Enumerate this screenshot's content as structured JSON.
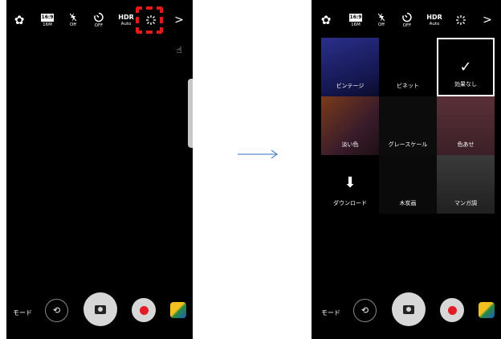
{
  "topbar": {
    "settings_icon": "gear-icon",
    "ratio": "16:9",
    "ratio_sub": "16M",
    "flash_sub": "Off",
    "timer_sub": "OFF",
    "hdr": "HDR",
    "hdr_sub": "Auto",
    "effects_icon": "magic-wand-icon",
    "more": ">"
  },
  "bottombar": {
    "mode_label": "モード",
    "switch_icon": "switch-camera-icon",
    "shutter_icon": "camera-icon",
    "record_icon": "record-icon",
    "gallery_icon": "gallery-thumbnail"
  },
  "gesture_icon": "hand-gesture-icon",
  "highlight_color": "#e21a1a",
  "arrow_color": "#2e6fc6",
  "effects": [
    {
      "label": "ビンテージ",
      "color": "#1b1f6a",
      "selected": false,
      "icon": ""
    },
    {
      "label": "ビネット",
      "color": "#000000",
      "selected": false,
      "icon": ""
    },
    {
      "label": "効果なし",
      "color": "#000000",
      "selected": true,
      "icon": "check-icon"
    },
    {
      "label": "淡い色",
      "color": "#5a2c1e",
      "selected": false,
      "icon": ""
    },
    {
      "label": "グレースケール",
      "color": "#0c0c0c",
      "selected": false,
      "icon": ""
    },
    {
      "label": "色あせ",
      "color": "#4a2830",
      "selected": false,
      "icon": ""
    },
    {
      "label": "ダウンロード",
      "color": "#000000",
      "selected": false,
      "icon": "download-icon"
    },
    {
      "label": "木炭画",
      "color": "#0a0a0a",
      "selected": false,
      "icon": ""
    },
    {
      "label": "マンガ調",
      "color": "#2b2b2b",
      "selected": false,
      "icon": ""
    }
  ]
}
